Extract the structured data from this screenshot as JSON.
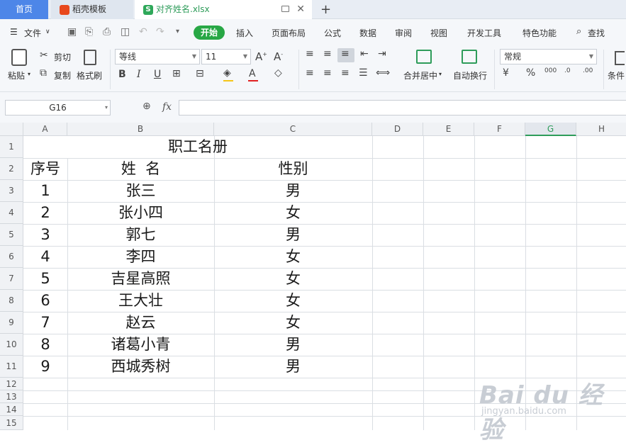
{
  "tabs": {
    "home": "首页",
    "docer": "稻壳模板",
    "file": "对齐姓名.xlsx",
    "close": "✕",
    "new": "+"
  },
  "menu": {
    "file": "文件",
    "start": "开始",
    "items": [
      "插入",
      "页面布局",
      "公式",
      "数据",
      "审阅",
      "视图",
      "开发工具",
      "特色功能"
    ],
    "search": "查找"
  },
  "ribbon": {
    "paste": "粘贴",
    "cut": "剪切",
    "copy": "复制",
    "format_painter": "格式刷",
    "font": "等线",
    "font_size": "11",
    "merge": "合并居中",
    "wrap": "自动换行",
    "number_format": "常规",
    "conditional": "条件"
  },
  "formula_bar": {
    "name_box": "G16",
    "fx": "fx",
    "value": ""
  },
  "columns": [
    "A",
    "B",
    "C",
    "D",
    "E",
    "F",
    "G",
    "H"
  ],
  "selected_column": "G",
  "rows": [
    "1",
    "2",
    "3",
    "4",
    "5",
    "6",
    "7",
    "8",
    "9",
    "10",
    "11",
    "12",
    "13",
    "14",
    "15"
  ],
  "sheet": {
    "title": "职工名册",
    "headers": [
      "序号",
      "姓  名",
      "性别"
    ],
    "records": [
      {
        "no": "1",
        "name": "张三",
        "sex": "男"
      },
      {
        "no": "2",
        "name": "张小四",
        "sex": "女"
      },
      {
        "no": "3",
        "name": "郭七",
        "sex": "男"
      },
      {
        "no": "4",
        "name": "李四",
        "sex": "女"
      },
      {
        "no": "5",
        "name": "吉星高照",
        "sex": "女"
      },
      {
        "no": "6",
        "name": "王大壮",
        "sex": "女"
      },
      {
        "no": "7",
        "name": "赵云",
        "sex": "女"
      },
      {
        "no": "8",
        "name": "诸葛小青",
        "sex": "男"
      },
      {
        "no": "9",
        "name": "西城秀树",
        "sex": "男"
      }
    ]
  },
  "watermark": {
    "brand": "Bai du 经验",
    "url": "jingyan.baidu.com"
  }
}
